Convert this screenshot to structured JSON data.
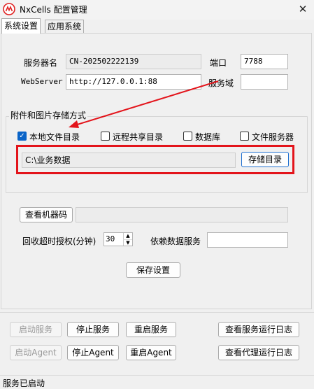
{
  "window": {
    "title": "NxCells 配置管理",
    "close_glyph": "✕"
  },
  "tabs": [
    {
      "label": "系统设置",
      "active": true
    },
    {
      "label": "应用系统",
      "active": false
    }
  ],
  "server": {
    "server_name_label": "服务器名",
    "server_name_value": "CN-202502222139",
    "port_label": "端口",
    "port_value": "7788",
    "webserver_label": "WebServer",
    "webserver_value": "http://127.0.0.1:88",
    "domain_label": "服务域",
    "domain_value": ""
  },
  "storage": {
    "group_title": "附件和图片存储方式",
    "options": [
      {
        "label": "本地文件目录",
        "checked": true
      },
      {
        "label": "远程共享目录",
        "checked": false
      },
      {
        "label": "数据库",
        "checked": false
      },
      {
        "label": "文件服务器",
        "checked": false
      }
    ],
    "path_value": "C:\\业务数据",
    "dir_button": "存储目录"
  },
  "machine": {
    "view_code_button": "查看机器码",
    "code_value": ""
  },
  "timeout": {
    "label": "回收超时授权(分钟)",
    "value": "30",
    "depend_label": "依赖数据服务",
    "depend_value": ""
  },
  "save_button": "保存设置",
  "controls": {
    "start_service": "启动服务",
    "stop_service": "停止服务",
    "restart_service": "重启服务",
    "view_service_log": "查看服务运行日志",
    "start_agent": "启动Agent",
    "stop_agent": "停止Agent",
    "restart_agent": "重启Agent",
    "view_agent_log": "查看代理运行日志"
  },
  "status": {
    "text": "服务已启动"
  },
  "colors": {
    "accent": "#0a64c8",
    "highlight": "#e3141b"
  }
}
